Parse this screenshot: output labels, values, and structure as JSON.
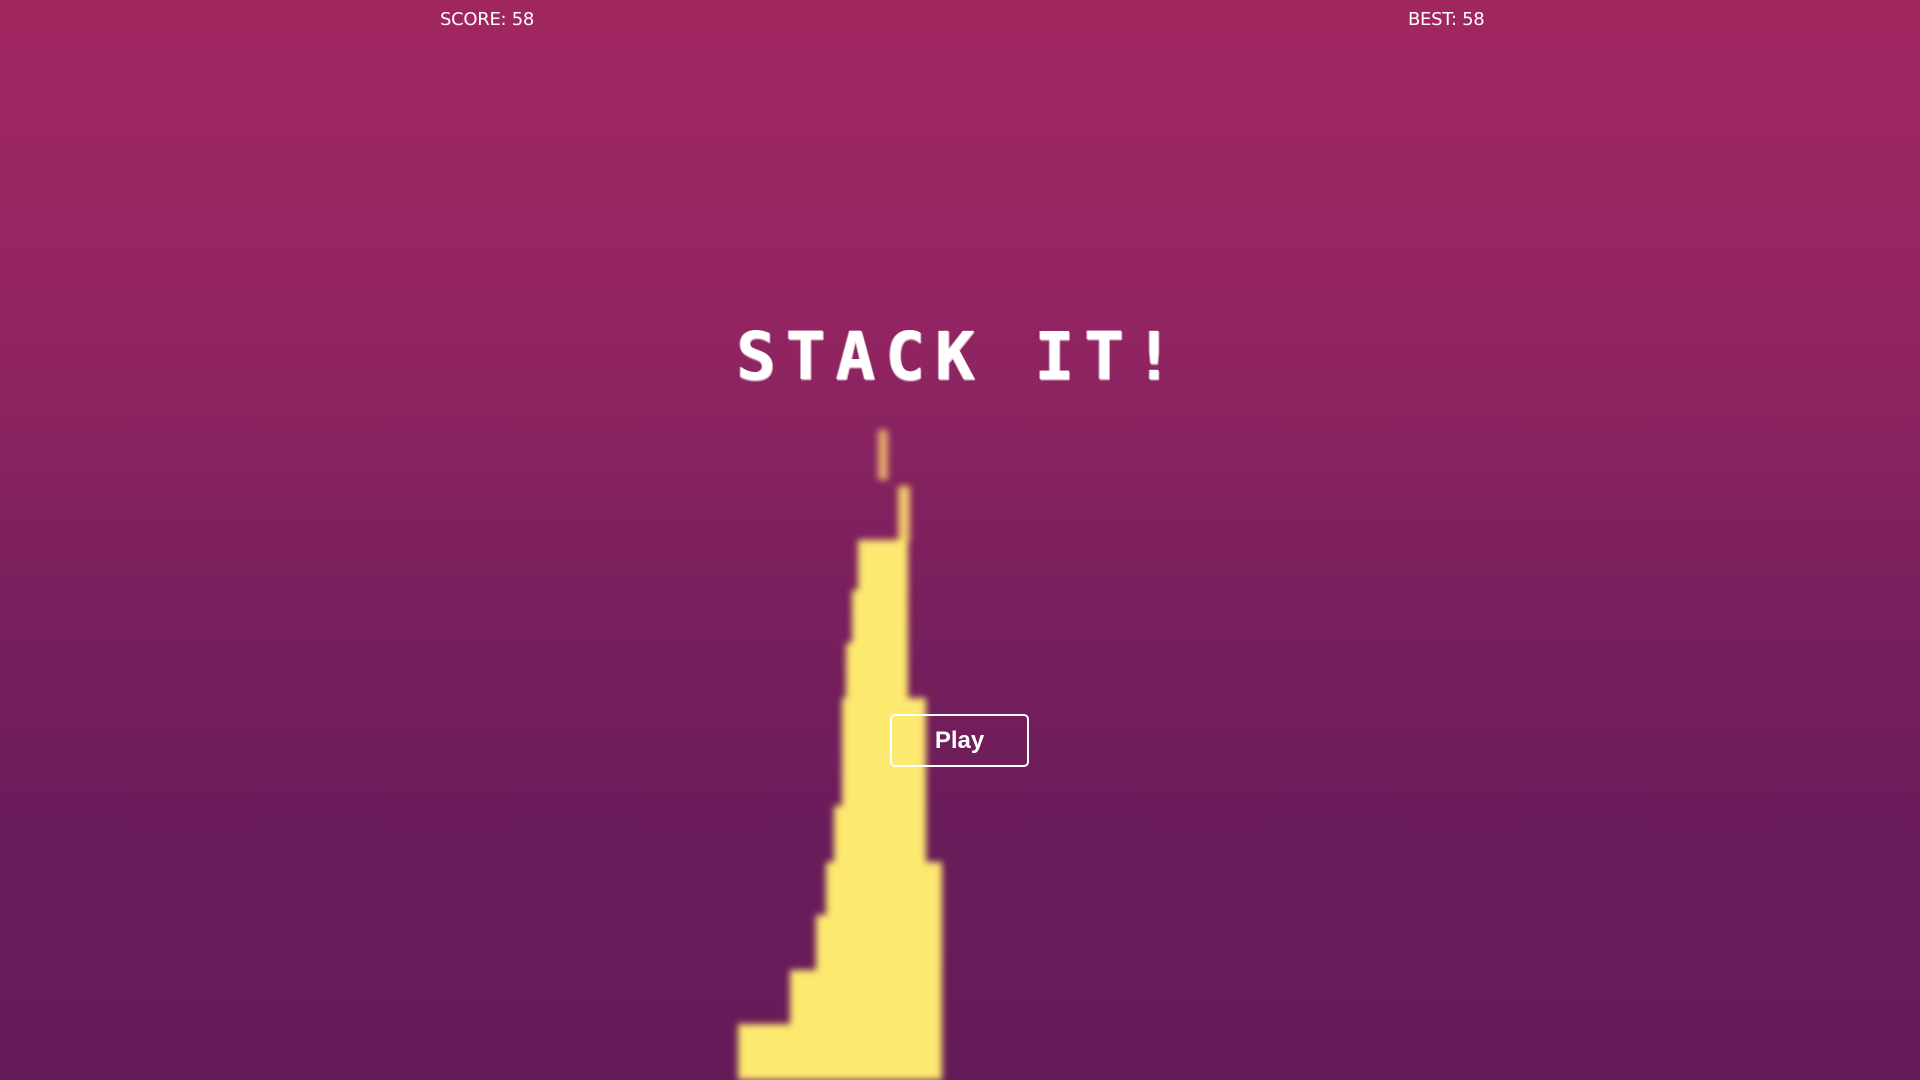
{
  "hud": {
    "score_label": "SCORE: 58",
    "best_label": "BEST: 58"
  },
  "title": "STACK IT!",
  "play_button": {
    "label": "Play"
  },
  "colors": {
    "background_top": "#a12660",
    "background_bottom": "#661b59",
    "block": "#fde870",
    "block_top": "#e7a96a",
    "text": "#ffffff"
  }
}
